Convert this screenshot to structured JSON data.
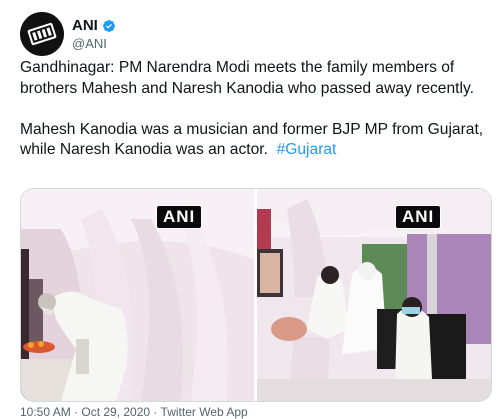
{
  "tweet": {
    "author_name": "ANI",
    "author_handle": "@ANI",
    "text_main": "Gandhinagar: PM Narendra Modi meets the family members of brothers Mahesh and Naresh Kanodia who passed away recently.\n\nMahesh Kanodia was a musician and former BJP MP from Gujarat, while Naresh Kanodia was an actor.  ",
    "hashtag": "#Gujarat",
    "footer": "10:50 AM · Oct 29, 2020 · Twitter Web App"
  },
  "media": {
    "left_watermark": "ANI",
    "right_watermark": "ANI"
  },
  "colors": {
    "link": "#1d9bf0",
    "secondary_text": "#536471",
    "verified": "#1d9bf0"
  },
  "icons": {
    "avatar": "ani-logo-icon",
    "verified": "verified-badge-icon"
  }
}
